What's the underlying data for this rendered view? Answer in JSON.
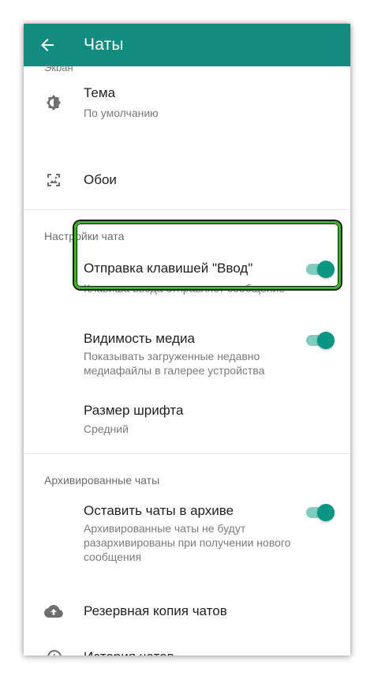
{
  "appbar": {
    "title": "Чаты",
    "back_icon": "arrow-back-icon",
    "color": "#128C7E"
  },
  "cut_header": "Экран",
  "display": {
    "theme": {
      "title": "Тема",
      "subtitle": "По умолчанию",
      "icon": "brightness-icon"
    },
    "wallpaper": {
      "title": "Обои",
      "icon": "wallpaper-icon"
    }
  },
  "chat_settings": {
    "header": "Настройки чата",
    "enter_send": {
      "title": "Отправка клавишей \"Ввод\"",
      "subtitle": "Клавиша ввода отправляет сообщение",
      "enabled": true
    },
    "media_visibility": {
      "title": "Видимость медиа",
      "subtitle": "Показывать загруженные недавно медиафайлы в галерее устройства",
      "enabled": true
    },
    "font_size": {
      "title": "Размер шрифта",
      "subtitle": "Средний"
    }
  },
  "archived": {
    "header": "Архивированные чаты",
    "keep_archived": {
      "title": "Оставить чаты в архиве",
      "subtitle": "Архивированные чаты не будут разархивированы при получении нового сообщения",
      "enabled": true
    }
  },
  "backup": {
    "title": "Резервная копия чатов",
    "icon": "cloud-upload-icon"
  },
  "history": {
    "title": "История чатов",
    "icon": "history-icon"
  },
  "accent_color": "#0a9683",
  "highlight_color": "#3cb423"
}
